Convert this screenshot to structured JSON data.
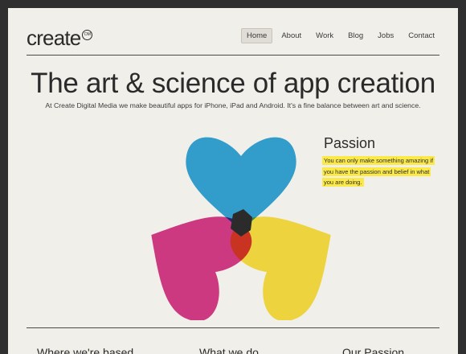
{
  "brand": {
    "logo_text": "create",
    "logo_badge": "DM"
  },
  "nav": {
    "items": [
      {
        "label": "Home",
        "active": true
      },
      {
        "label": "About",
        "active": false
      },
      {
        "label": "Work",
        "active": false
      },
      {
        "label": "Blog",
        "active": false
      },
      {
        "label": "Jobs",
        "active": false
      },
      {
        "label": "Contact",
        "active": false
      }
    ]
  },
  "hero": {
    "headline": "The art & science of app creation",
    "subheadline": "At Create Digital Media we make beautiful apps for iPhone, iPad and Android. It's a fine balance between art and science."
  },
  "illustration": {
    "name": "three-hearts-venn",
    "colors": {
      "cyan": "#35a7dc",
      "magenta": "#d83c8c",
      "yellow": "#fbe243",
      "blue_overlap": "#27358a",
      "green_overlap": "#3a9b4b",
      "red_overlap": "#e0373c",
      "center": "#2b2b2b"
    }
  },
  "passion": {
    "title": "Passion",
    "text": "You can only make something amazing if you have the passion and belief in what you are doing.",
    "highlight_color": "#fbe94a"
  },
  "sections": [
    {
      "title": "Where we're based"
    },
    {
      "title": "What we do"
    },
    {
      "title": "Our Passion"
    }
  ],
  "colors": {
    "page_background": "#f1efea",
    "frame_background": "#2f2f2f",
    "text": "#2a2a2a"
  }
}
